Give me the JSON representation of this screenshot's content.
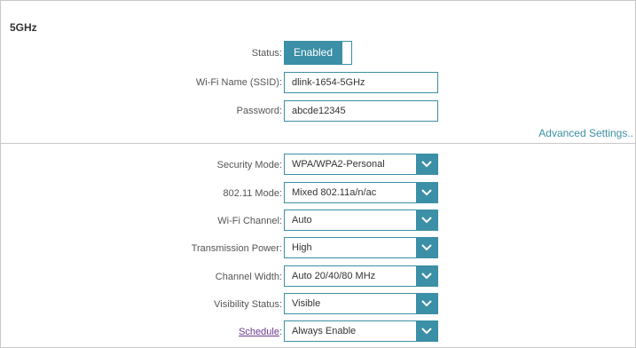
{
  "section": {
    "title": "5GHz"
  },
  "status": {
    "label": "Status:",
    "value": "Enabled"
  },
  "ssid": {
    "label": "Wi-Fi Name (SSID):",
    "value": "dlink-1654-5GHz"
  },
  "password": {
    "label": "Password:",
    "value": "abcde12345"
  },
  "advanced_link": "Advanced Settings..",
  "fields": [
    {
      "label": "Security Mode:",
      "value": "WPA/WPA2-Personal"
    },
    {
      "label": "802.11 Mode:",
      "value": "Mixed 802.11a/n/ac"
    },
    {
      "label": "Wi-Fi Channel:",
      "value": "Auto"
    },
    {
      "label": "Transmission Power:",
      "value": "High"
    },
    {
      "label": "Channel Width:",
      "value": "Auto 20/40/80 MHz"
    },
    {
      "label": "Visibility Status:",
      "value": "Visible"
    },
    {
      "label": "Schedule",
      "value": "Always Enable"
    }
  ],
  "schedule_colon": ":",
  "colors": {
    "accent": "#3b8fa6",
    "link_purple": "#6b3a8f",
    "border": "#c8c8c8"
  },
  "icons": {
    "dropdown": "chevron-down-icon"
  }
}
